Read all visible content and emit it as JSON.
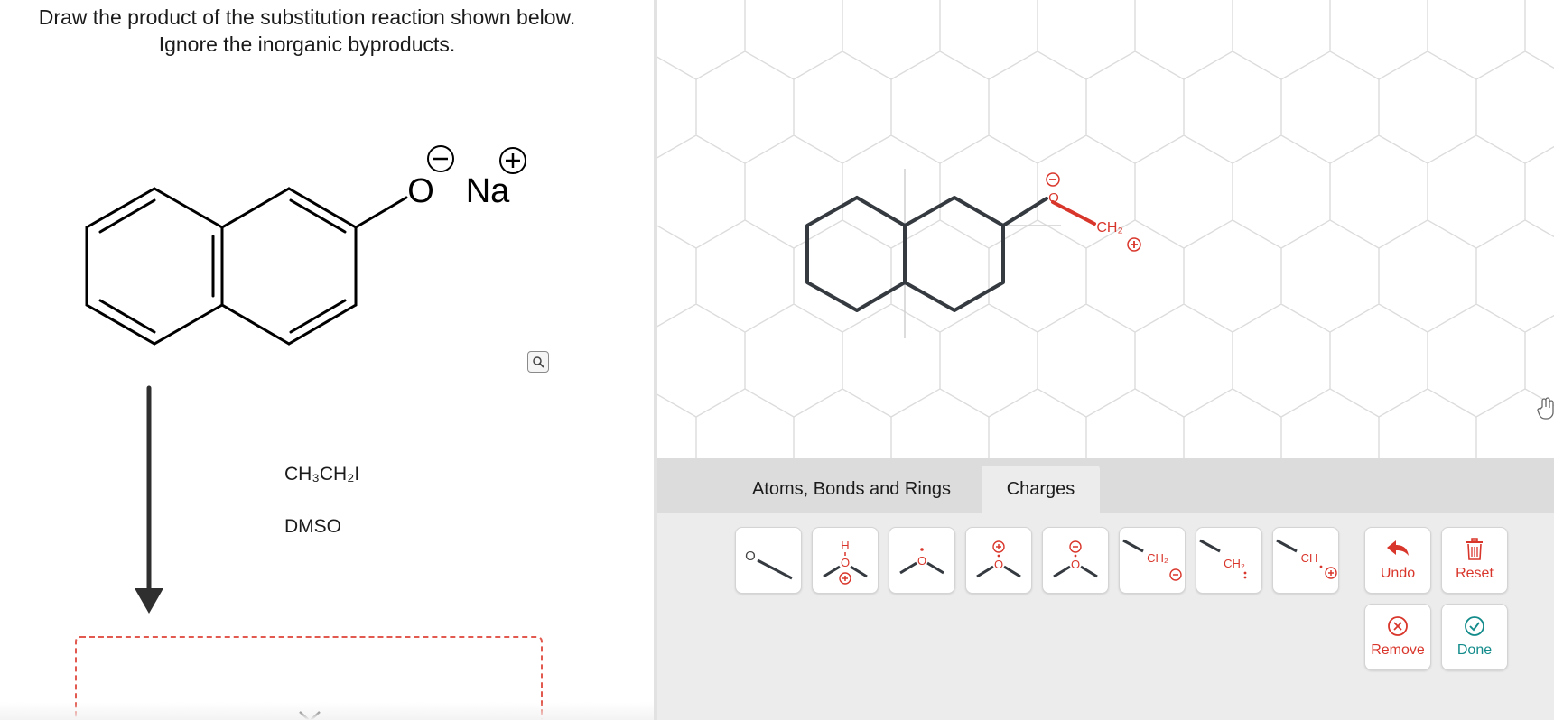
{
  "question": {
    "line1": "Draw the product of the substitution reaction shown below.",
    "line2": "Ignore the inorganic byproducts."
  },
  "starting_material": {
    "oxygen_label": "O",
    "counterion_label": "Na"
  },
  "reagents": [
    "CH₃CH₂I",
    "DMSO"
  ],
  "editor": {
    "drawn_fragment_label": "CH₂",
    "drawn_oxygen_label": "O",
    "tabs": [
      {
        "label": "Atoms, Bonds and Rings",
        "active": false
      },
      {
        "label": "Charges",
        "active": true
      }
    ],
    "tools": [
      {
        "icon": "ether-oxygen-icon",
        "label": "O"
      },
      {
        "icon": "hydroxy-oxonium-icon",
        "label": "H"
      },
      {
        "icon": "oxygen-radical-icon",
        "label": "O"
      },
      {
        "icon": "oxonium-positive-icon",
        "label": "O"
      },
      {
        "icon": "alkoxide-negative-icon",
        "label": "O"
      },
      {
        "icon": "carbanion-icon",
        "label": "CH₂"
      },
      {
        "icon": "carbene-icon",
        "label": "CH₂"
      },
      {
        "icon": "carbocation-icon",
        "label": "CH"
      }
    ],
    "actions": {
      "undo": "Undo",
      "reset": "Reset",
      "remove": "Remove",
      "done": "Done"
    }
  },
  "colors": {
    "accent_red": "#d9362b",
    "accent_teal": "#138b8b",
    "bond": "#343a40",
    "grid": "#dcdcdc"
  }
}
